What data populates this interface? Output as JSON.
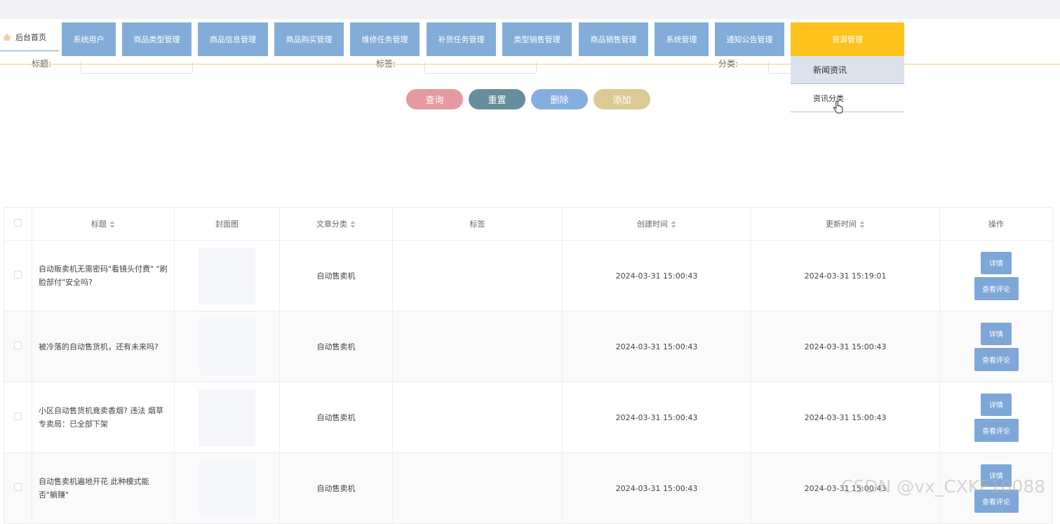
{
  "nav": {
    "home_label": "后台首页",
    "items": [
      {
        "label": "系统用户"
      },
      {
        "label": "商品类型管理"
      },
      {
        "label": "商品信息管理"
      },
      {
        "label": "商品购买管理"
      },
      {
        "label": "维修任务管理"
      },
      {
        "label": "补货任务管理"
      },
      {
        "label": "类型销售管理"
      },
      {
        "label": "商品销售管理"
      },
      {
        "label": "系统管理"
      },
      {
        "label": "通知公告管理"
      },
      {
        "label": "资源管理",
        "active": true
      }
    ],
    "dropdown": [
      "新闻资讯",
      "资讯分类"
    ]
  },
  "search": {
    "label_1": "标题:",
    "label_2": "标签:",
    "label_3": "分类:"
  },
  "buttons": {
    "query": "查询",
    "reset": "重置",
    "delete": "删除",
    "add": "添加"
  },
  "table": {
    "headers": [
      "标题",
      "封面图",
      "文章分类",
      "标签",
      "创建时间",
      "更新时间",
      "操作"
    ],
    "detail_label": "详情",
    "comment_label": "查看评论",
    "rows": [
      {
        "title": "自动贩卖机无需密码\"看镜头付费\" \"刷脸部付\"安全吗?",
        "category": "自动售卖机",
        "tag": "",
        "created": "2024-03-31 15:00:43",
        "updated": "2024-03-31 15:19:01"
      },
      {
        "title": "被冷落的自动售货机，还有未来吗?",
        "category": "自动售卖机",
        "tag": "",
        "created": "2024-03-31 15:00:43",
        "updated": "2024-03-31 15:00:43"
      },
      {
        "title": "小区自动售货机竟卖香烟? 违法 烟草专卖局：已全部下架",
        "category": "自动售卖机",
        "tag": "",
        "created": "2024-03-31 15:00:43",
        "updated": "2024-03-31 15:00:43"
      },
      {
        "title": "自动售卖机遍地开花 此种模式能否\"躺赚\"",
        "category": "自动售卖机",
        "tag": "",
        "created": "2024-03-31 15:00:43",
        "updated": "2024-03-31 15:00:43"
      }
    ]
  },
  "watermark": "CSDN @vx_CXKF10088",
  "colors": {
    "nav": "#83add8",
    "nav_active": "#fdc21b",
    "query": "#e49aa0",
    "reset": "#688d9c",
    "delete": "#86ade0",
    "add": "#dcca94"
  }
}
